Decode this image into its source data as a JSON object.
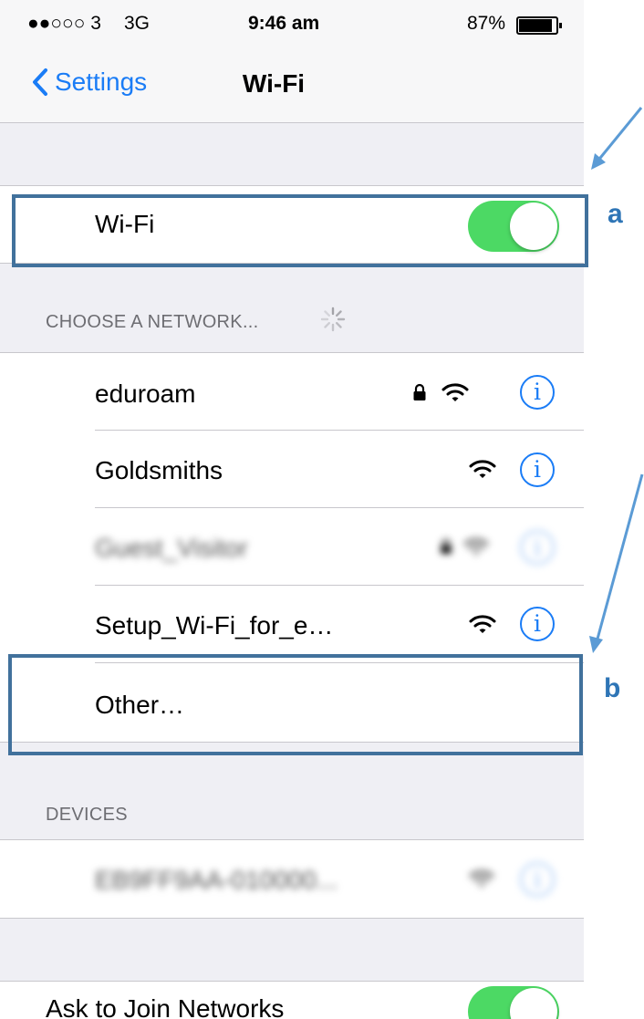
{
  "status_bar": {
    "signal": "●●○○○ 3",
    "network": "3G",
    "time": "9:46 am",
    "battery": "87%"
  },
  "nav": {
    "back_label": "Settings",
    "title": "Wi-Fi"
  },
  "wifi_toggle": {
    "label": "Wi-Fi",
    "on": true
  },
  "choose_header": "CHOOSE A NETWORK...",
  "networks": [
    {
      "name": "eduroam",
      "locked": true,
      "blurred": false
    },
    {
      "name": "Goldsmiths",
      "locked": false,
      "blurred": false
    },
    {
      "name": "Guest_Visitor",
      "locked": true,
      "blurred": true
    },
    {
      "name": "Setup_Wi-Fi_for_e…",
      "locked": false,
      "blurred": false
    }
  ],
  "other_label": "Other…",
  "devices_header": "DEVICES",
  "devices": [
    {
      "name": "EB9FF9AA-010000...",
      "blurred": true
    }
  ],
  "ask_to_join": {
    "label": "Ask to Join Networks",
    "on": true
  },
  "annotations": {
    "a": "a",
    "b": "b",
    "color": "#41719c"
  },
  "colors": {
    "accent": "#1a7cf6",
    "toggle_on": "#4cd964"
  }
}
